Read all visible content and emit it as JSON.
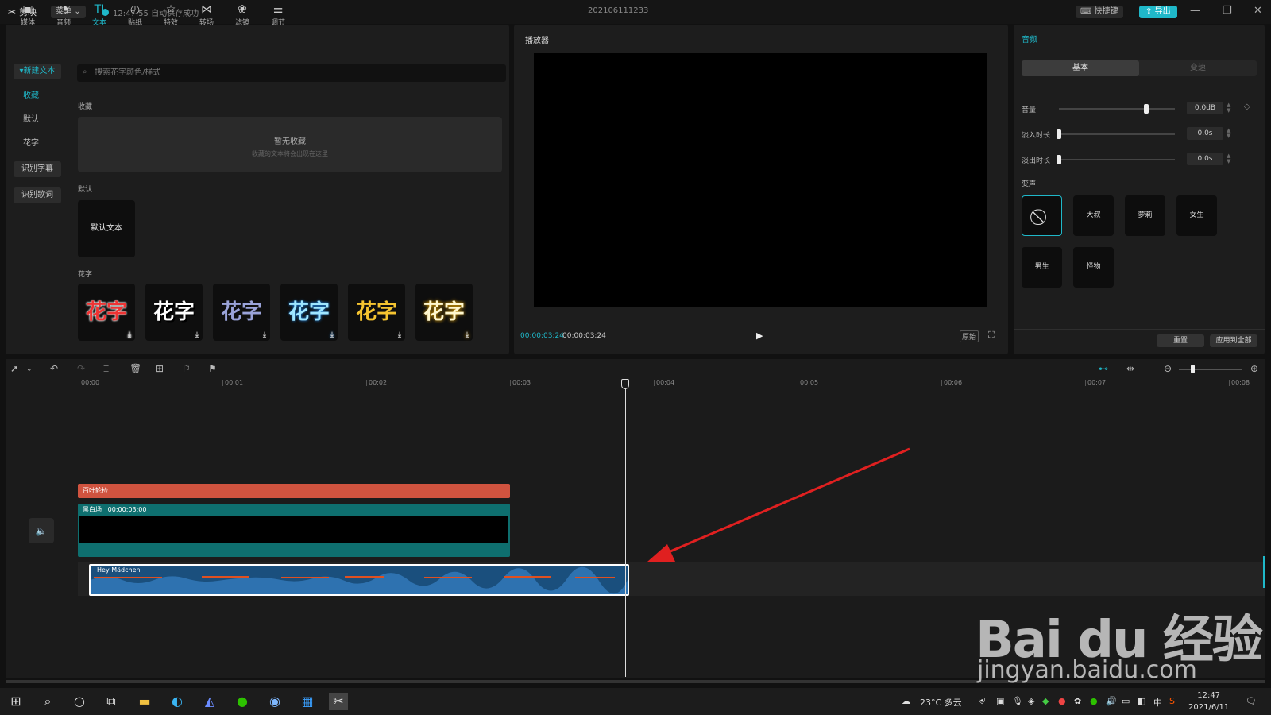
{
  "titlebar": {
    "app_name": "剪映",
    "menu_label": "菜单",
    "save_status": "12:47:55 自动保存成功",
    "project_title": "202106111233",
    "shortcut_label": "快捷键",
    "export_label": "导出"
  },
  "toolbar": {
    "items": [
      {
        "label": "媒体",
        "icon": "media-icon"
      },
      {
        "label": "音频",
        "icon": "audio-icon"
      },
      {
        "label": "文本",
        "icon": "text-icon"
      },
      {
        "label": "贴纸",
        "icon": "sticker-icon"
      },
      {
        "label": "特效",
        "icon": "effect-icon"
      },
      {
        "label": "转场",
        "icon": "transition-icon"
      },
      {
        "label": "滤镜",
        "icon": "filter-icon"
      },
      {
        "label": "调节",
        "icon": "adjust-icon"
      }
    ],
    "active": "文本"
  },
  "text_sidebar": {
    "new_text": "新建文本",
    "items": [
      "收藏",
      "默认",
      "花字"
    ],
    "recognize_subtitle": "识别字幕",
    "recognize_lyrics": "识别歌词"
  },
  "text_panel": {
    "search_placeholder": "搜索花字颜色/样式",
    "favorites_label": "收藏",
    "empty_title": "暂无收藏",
    "empty_hint": "收藏的文本将会出现在这里",
    "default_label": "默认",
    "default_text": "默认文本",
    "huazi_label": "花字",
    "huazi_tiles": [
      "花字",
      "花字",
      "花字",
      "花字",
      "花字",
      "花字"
    ]
  },
  "player": {
    "title": "播放器",
    "current_time": "00:00:03:24",
    "total_time": "00:00:03:24",
    "original_label": "原始"
  },
  "audio_panel": {
    "title": "音频",
    "tabs": [
      "基本",
      "变速"
    ],
    "volume_label": "音量",
    "volume_value": "0.0dB",
    "volume_level": 0.75,
    "fade_in_label": "淡入时长",
    "fade_in_value": "0.0s",
    "fade_out_label": "淡出时长",
    "fade_out_value": "0.0s",
    "voice_change_label": "变声",
    "voices": [
      "大叔",
      "萝莉",
      "女生",
      "男生",
      "怪物"
    ],
    "reset_label": "重置",
    "apply_all_label": "应用到全部"
  },
  "timeline": {
    "ruler": [
      "00:00",
      "00:01",
      "00:02",
      "00:03",
      "00:04",
      "00:05",
      "00:06",
      "00:07",
      "00:08"
    ],
    "effect_clip": "百叶轮检",
    "video_clip_name": "黑白场",
    "video_clip_duration": "00:00:03:00",
    "audio_clip_name": "Hey Mädchen"
  },
  "watermark": {
    "logo": "Bai du 经验",
    "url": "jingyan.baidu.com"
  },
  "taskbar": {
    "weather": "23°C 多云",
    "ime": "中",
    "time": "12:47",
    "date": "2021/6/11"
  },
  "colors": {
    "accent": "#1fb8c9",
    "effect_clip": "#d0533f",
    "video_clip": "#0e6f6f",
    "audio_clip": "#1a4f7d",
    "arrow": "#e02020"
  }
}
